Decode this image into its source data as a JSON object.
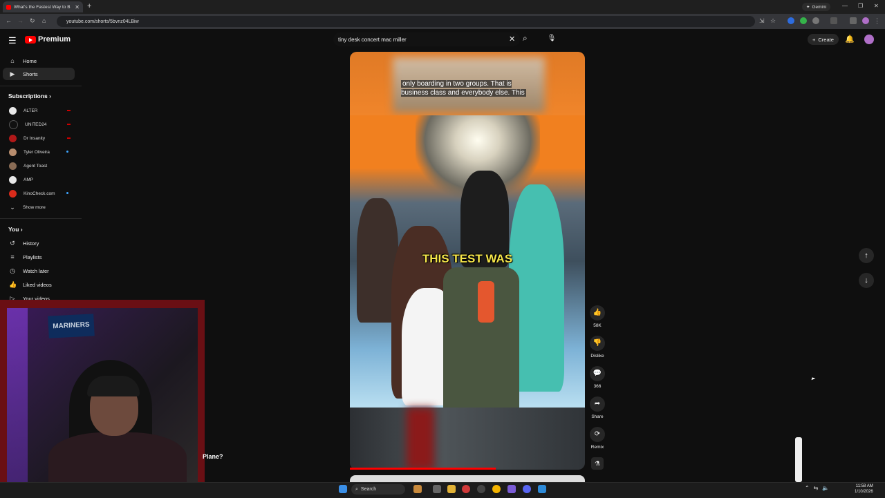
{
  "browser": {
    "tab_title": "What's the Fastest Way to B",
    "tab_close": "✕",
    "new_tab": "+",
    "gemini": "Gemini",
    "url": "youtube.com/shorts/5bvnz04LBiw",
    "window_controls": [
      "—",
      "❐",
      "✕"
    ]
  },
  "header": {
    "brand": "Premium",
    "search_query": "tiny desk concert mac miller",
    "create_label": "Create"
  },
  "sidebar": {
    "top": [
      {
        "label": "Home",
        "icon": "home-icon"
      },
      {
        "label": "Shorts",
        "icon": "shorts-icon",
        "active": true
      }
    ],
    "subscriptions_title": "Subscriptions",
    "subscriptions": [
      {
        "label": "ALTER",
        "color": "#e8e8e8",
        "badge": "live"
      },
      {
        "label": "UNITED24",
        "color": "#111111",
        "badge": "live"
      },
      {
        "label": "Dr Insanity",
        "color": "#b01818",
        "badge": "live"
      },
      {
        "label": "Tyler Oliveira",
        "color": "#b88d6e",
        "badge": "dot"
      },
      {
        "label": "Agent Toast",
        "color": "#8a6c55",
        "badge": ""
      },
      {
        "label": "AMP",
        "color": "#e8e8e8",
        "badge": ""
      },
      {
        "label": "KinoCheck.com",
        "color": "#d92b1b",
        "badge": "dot"
      }
    ],
    "show_more": "Show more",
    "you_title": "You",
    "you": [
      {
        "label": "History",
        "icon": "history-icon"
      },
      {
        "label": "Playlists",
        "icon": "playlists-icon"
      },
      {
        "label": "Watch later",
        "icon": "watch-later-icon"
      },
      {
        "label": "Liked videos",
        "icon": "liked-videos-icon"
      },
      {
        "label": "Your videos",
        "icon": "your-videos-icon"
      }
    ]
  },
  "video": {
    "top_caption": "only boarding in two groups. That is business class and everybody else. This",
    "main_caption": "THIS TEST WAS",
    "progress": 0.62
  },
  "actions": {
    "like_count": "58K",
    "dislike_label": "Dislike",
    "comment_count": "366",
    "share_label": "Share",
    "remix_label": "Remix"
  },
  "overlay": {
    "banner_text": "MARINERS",
    "partial_title": "Plane?"
  },
  "taskbar": {
    "search_label": "Search",
    "time": "11:58 AM",
    "date": "1/10/2026"
  },
  "colors": {
    "accent": "#ff0000",
    "background": "#0f0f0f",
    "webcam_border": "#6a0f14"
  }
}
